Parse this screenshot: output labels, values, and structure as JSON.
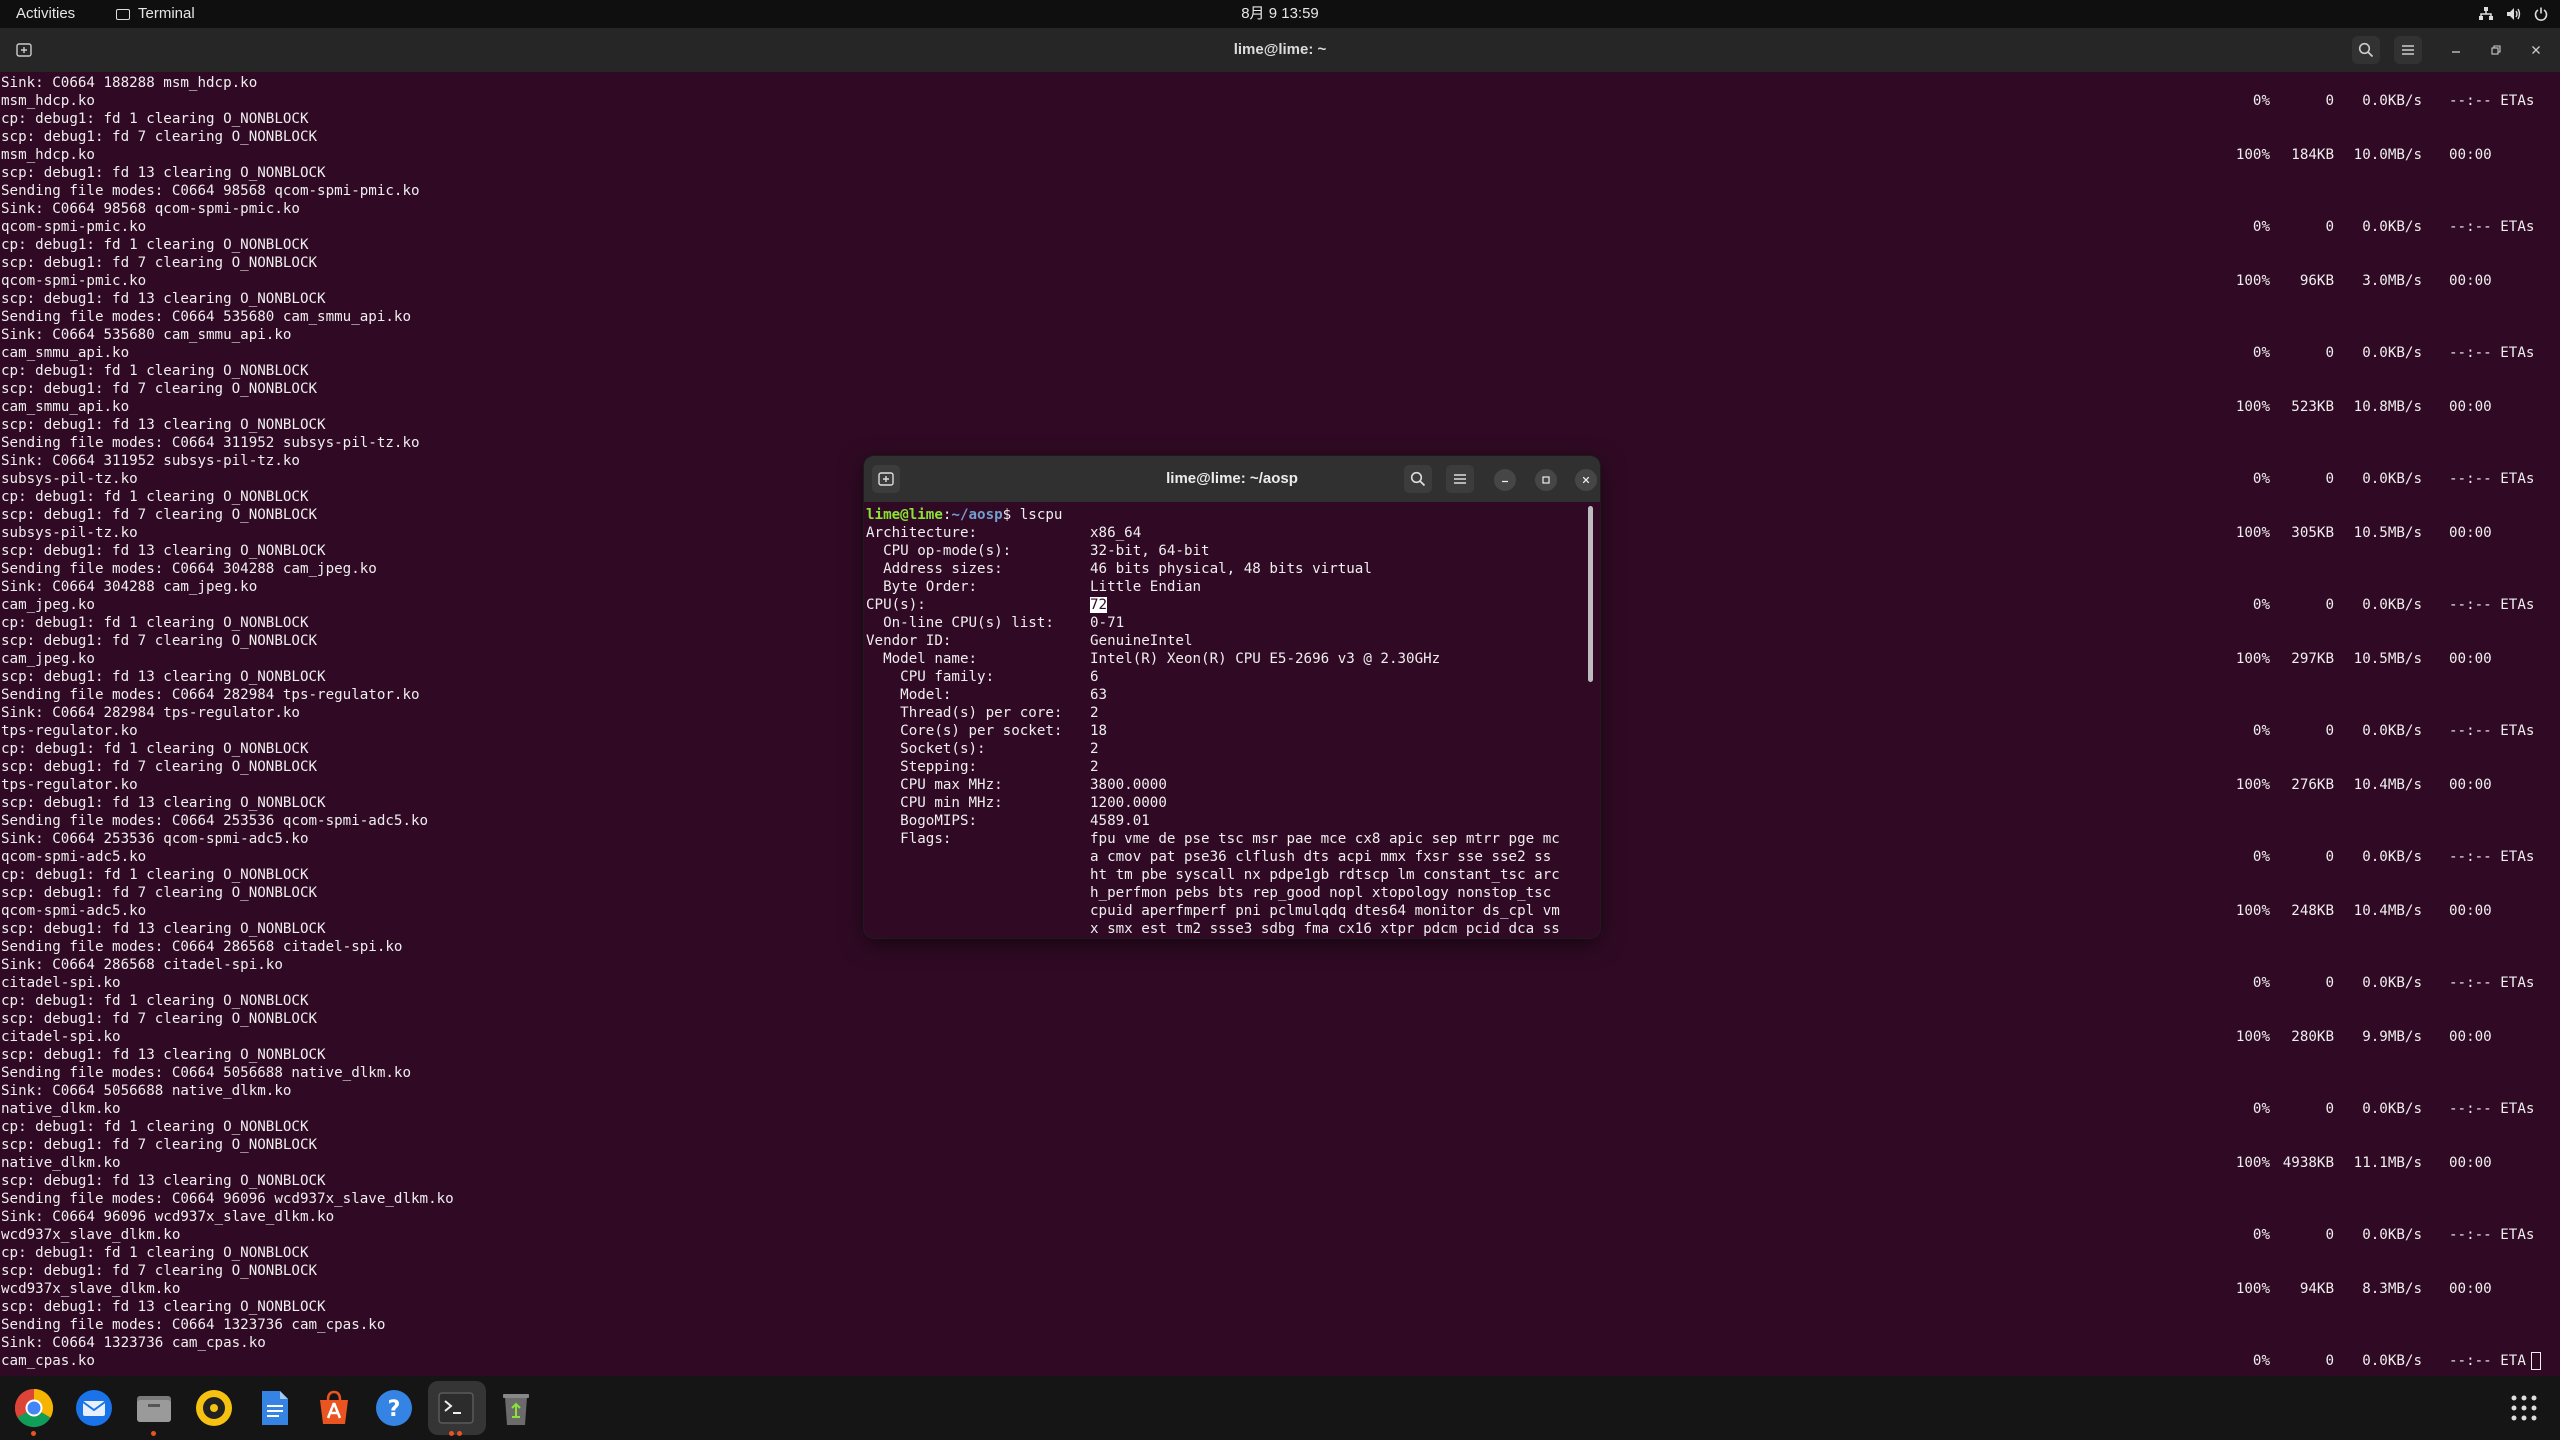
{
  "topbar": {
    "activities": "Activities",
    "app_name": "Terminal",
    "clock": "8月 9  13:59"
  },
  "main_window": {
    "title": "lime@lime: ~",
    "log_lines": [
      "Sink: C0664 188288 msm_hdcp.ko",
      "msm_hdcp.ko",
      "cp: debug1: fd 1 clearing O_NONBLOCK",
      "scp: debug1: fd 7 clearing O_NONBLOCK",
      "msm_hdcp.ko",
      "scp: debug1: fd 13 clearing O_NONBLOCK",
      "Sending file modes: C0664 98568 qcom-spmi-pmic.ko",
      "Sink: C0664 98568 qcom-spmi-pmic.ko",
      "qcom-spmi-pmic.ko",
      "cp: debug1: fd 1 clearing O_NONBLOCK",
      "scp: debug1: fd 7 clearing O_NONBLOCK",
      "qcom-spmi-pmic.ko",
      "scp: debug1: fd 13 clearing O_NONBLOCK",
      "Sending file modes: C0664 535680 cam_smmu_api.ko",
      "Sink: C0664 535680 cam_smmu_api.ko",
      "cam_smmu_api.ko",
      "cp: debug1: fd 1 clearing O_NONBLOCK",
      "scp: debug1: fd 7 clearing O_NONBLOCK",
      "cam_smmu_api.ko",
      "scp: debug1: fd 13 clearing O_NONBLOCK",
      "Sending file modes: C0664 311952 subsys-pil-tz.ko",
      "Sink: C0664 311952 subsys-pil-tz.ko",
      "subsys-pil-tz.ko",
      "cp: debug1: fd 1 clearing O_NONBLOCK",
      "scp: debug1: fd 7 clearing O_NONBLOCK",
      "subsys-pil-tz.ko",
      "scp: debug1: fd 13 clearing O_NONBLOCK",
      "Sending file modes: C0664 304288 cam_jpeg.ko",
      "Sink: C0664 304288 cam_jpeg.ko",
      "cam_jpeg.ko",
      "cp: debug1: fd 1 clearing O_NONBLOCK",
      "scp: debug1: fd 7 clearing O_NONBLOCK",
      "cam_jpeg.ko",
      "scp: debug1: fd 13 clearing O_NONBLOCK",
      "Sending file modes: C0664 282984 tps-regulator.ko",
      "Sink: C0664 282984 tps-regulator.ko",
      "tps-regulator.ko",
      "cp: debug1: fd 1 clearing O_NONBLOCK",
      "scp: debug1: fd 7 clearing O_NONBLOCK",
      "tps-regulator.ko",
      "scp: debug1: fd 13 clearing O_NONBLOCK",
      "Sending file modes: C0664 253536 qcom-spmi-adc5.ko",
      "Sink: C0664 253536 qcom-spmi-adc5.ko",
      "qcom-spmi-adc5.ko",
      "cp: debug1: fd 1 clearing O_NONBLOCK",
      "scp: debug1: fd 7 clearing O_NONBLOCK",
      "qcom-spmi-adc5.ko",
      "scp: debug1: fd 13 clearing O_NONBLOCK",
      "Sending file modes: C0664 286568 citadel-spi.ko",
      "Sink: C0664 286568 citadel-spi.ko",
      "citadel-spi.ko",
      "cp: debug1: fd 1 clearing O_NONBLOCK",
      "scp: debug1: fd 7 clearing O_NONBLOCK",
      "citadel-spi.ko",
      "scp: debug1: fd 13 clearing O_NONBLOCK",
      "Sending file modes: C0664 5056688 native_dlkm.ko",
      "Sink: C0664 5056688 native_dlkm.ko",
      "native_dlkm.ko",
      "cp: debug1: fd 1 clearing O_NONBLOCK",
      "scp: debug1: fd 7 clearing O_NONBLOCK",
      "native_dlkm.ko",
      "scp: debug1: fd 13 clearing O_NONBLOCK",
      "Sending file modes: C0664 96096 wcd937x_slave_dlkm.ko",
      "Sink: C0664 96096 wcd937x_slave_dlkm.ko",
      "wcd937x_slave_dlkm.ko",
      "cp: debug1: fd 1 clearing O_NONBLOCK",
      "scp: debug1: fd 7 clearing O_NONBLOCK",
      "wcd937x_slave_dlkm.ko",
      "scp: debug1: fd 13 clearing O_NONBLOCK",
      "Sending file modes: C0664 1323736 cam_cpas.ko",
      "Sink: C0664 1323736 cam_cpas.ko",
      "cam_cpas.ko"
    ],
    "progress_rows": [
      {
        "line": 1,
        "pct": "0%",
        "size": "0",
        "rate": "0.0KB/s",
        "eta": "--:-- ETAs"
      },
      {
        "line": 4,
        "pct": "100%",
        "size": "184KB",
        "rate": "10.0MB/s",
        "eta": "00:00"
      },
      {
        "line": 8,
        "pct": "0%",
        "size": "0",
        "rate": "0.0KB/s",
        "eta": "--:-- ETAs"
      },
      {
        "line": 11,
        "pct": "100%",
        "size": "96KB",
        "rate": "3.0MB/s",
        "eta": "00:00"
      },
      {
        "line": 15,
        "pct": "0%",
        "size": "0",
        "rate": "0.0KB/s",
        "eta": "--:-- ETAs"
      },
      {
        "line": 18,
        "pct": "100%",
        "size": "523KB",
        "rate": "10.8MB/s",
        "eta": "00:00"
      },
      {
        "line": 22,
        "pct": "0%",
        "size": "0",
        "rate": "0.0KB/s",
        "eta": "--:-- ETAs"
      },
      {
        "line": 25,
        "pct": "100%",
        "size": "305KB",
        "rate": "10.5MB/s",
        "eta": "00:00"
      },
      {
        "line": 29,
        "pct": "0%",
        "size": "0",
        "rate": "0.0KB/s",
        "eta": "--:-- ETAs"
      },
      {
        "line": 32,
        "pct": "100%",
        "size": "297KB",
        "rate": "10.5MB/s",
        "eta": "00:00"
      },
      {
        "line": 36,
        "pct": "0%",
        "size": "0",
        "rate": "0.0KB/s",
        "eta": "--:-- ETAs"
      },
      {
        "line": 39,
        "pct": "100%",
        "size": "276KB",
        "rate": "10.4MB/s",
        "eta": "00:00"
      },
      {
        "line": 43,
        "pct": "0%",
        "size": "0",
        "rate": "0.0KB/s",
        "eta": "--:-- ETAs"
      },
      {
        "line": 46,
        "pct": "100%",
        "size": "248KB",
        "rate": "10.4MB/s",
        "eta": "00:00"
      },
      {
        "line": 50,
        "pct": "0%",
        "size": "0",
        "rate": "0.0KB/s",
        "eta": "--:-- ETAs"
      },
      {
        "line": 53,
        "pct": "100%",
        "size": "280KB",
        "rate": "9.9MB/s",
        "eta": "00:00"
      },
      {
        "line": 57,
        "pct": "0%",
        "size": "0",
        "rate": "0.0KB/s",
        "eta": "--:-- ETAs"
      },
      {
        "line": 60,
        "pct": "100%",
        "size": "4938KB",
        "rate": "11.1MB/s",
        "eta": "00:00"
      },
      {
        "line": 64,
        "pct": "0%",
        "size": "0",
        "rate": "0.0KB/s",
        "eta": "--:-- ETAs"
      },
      {
        "line": 67,
        "pct": "100%",
        "size": "94KB",
        "rate": "8.3MB/s",
        "eta": "00:00"
      },
      {
        "line": 71,
        "pct": "0%",
        "size": "0",
        "rate": "0.0KB/s",
        "eta": "--:-- ETA"
      }
    ]
  },
  "mini_window": {
    "title": "lime@lime: ~/aosp",
    "prompt_user": "lime@lime",
    "prompt_sep": ":",
    "prompt_path": "~/aosp",
    "prompt_symbol": "$ ",
    "command": "lscpu",
    "rows": [
      {
        "key": "Architecture:",
        "value": "x86_64"
      },
      {
        "key": "  CPU op-mode(s):",
        "value": "32-bit, 64-bit"
      },
      {
        "key": "  Address sizes:",
        "value": "46 bits physical, 48 bits virtual"
      },
      {
        "key": "  Byte Order:",
        "value": "Little Endian"
      },
      {
        "key": "CPU(s):",
        "value": "72",
        "selected": true
      },
      {
        "key": "  On-line CPU(s) list:",
        "value": "0-71"
      },
      {
        "key": "Vendor ID:",
        "value": "GenuineIntel"
      },
      {
        "key": "  Model name:",
        "value": "Intel(R) Xeon(R) CPU E5-2696 v3 @ 2.30GHz"
      },
      {
        "key": "    CPU family:",
        "value": "6"
      },
      {
        "key": "    Model:",
        "value": "63"
      },
      {
        "key": "    Thread(s) per core:",
        "value": "2"
      },
      {
        "key": "    Core(s) per socket:",
        "value": "18"
      },
      {
        "key": "    Socket(s):",
        "value": "2"
      },
      {
        "key": "    Stepping:",
        "value": "2"
      },
      {
        "key": "    CPU max MHz:",
        "value": "3800.0000"
      },
      {
        "key": "    CPU min MHz:",
        "value": "1200.0000"
      },
      {
        "key": "    BogoMIPS:",
        "value": "4589.01"
      },
      {
        "key": "    Flags:",
        "value": "fpu vme de pse tsc msr pae mce cx8 apic sep mtrr pge mc"
      },
      {
        "key": "",
        "value": "a cmov pat pse36 clflush dts acpi mmx fxsr sse sse2 ss"
      },
      {
        "key": "",
        "value": "ht tm pbe syscall nx pdpe1gb rdtscp lm constant_tsc arc"
      },
      {
        "key": "",
        "value": "h_perfmon pebs bts rep_good nopl xtopology nonstop_tsc"
      },
      {
        "key": "",
        "value": "cpuid aperfmperf pni pclmulqdq dtes64 monitor ds_cpl vm"
      },
      {
        "key": "",
        "value": "x smx est tm2 ssse3 sdbg fma cx16 xtpr pdcm pcid dca ss"
      }
    ]
  },
  "dock": {
    "apps": [
      "chrome-icon",
      "thunderbird-icon",
      "files-icon",
      "rhythmbox-icon",
      "writer-icon",
      "app-center-icon",
      "help-icon",
      "terminal-icon",
      "trash-icon",
      "show-apps-icon"
    ]
  },
  "colors": {
    "terminal_bg": "#300a24",
    "accent": "#e95420",
    "prompt_user": "#8ae234",
    "prompt_path": "#729fcf"
  }
}
